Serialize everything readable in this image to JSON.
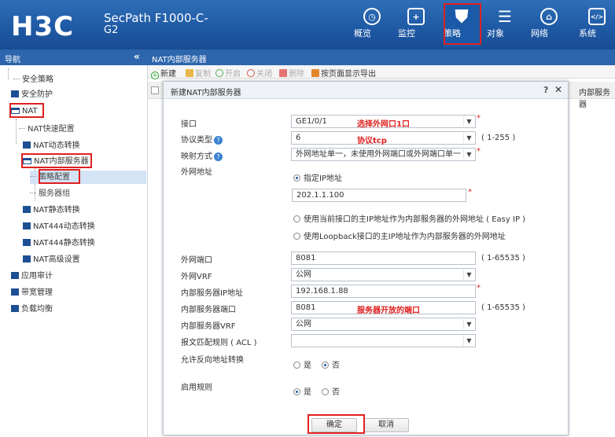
{
  "header": {
    "logo": "H3C",
    "product_line1": "SecPath F1000-C-",
    "product_line2": "G2",
    "nav": [
      {
        "label": "概览",
        "icon": "dashboard-icon",
        "glyph": "◷"
      },
      {
        "label": "监控",
        "icon": "monitor-icon",
        "glyph": "+"
      },
      {
        "label": "策略",
        "icon": "shield-icon",
        "glyph": "⛊"
      },
      {
        "label": "对象",
        "icon": "object-list-icon",
        "glyph": "☰"
      },
      {
        "label": "网络",
        "icon": "network-icon",
        "glyph": "⌂"
      },
      {
        "label": "系统",
        "icon": "code-icon",
        "glyph": "</>"
      }
    ]
  },
  "subbar": {
    "nav_title": "导航",
    "collapse": "«",
    "breadcrumb": "NAT内部服务器"
  },
  "sidebar": {
    "items": [
      {
        "label": "安全策略",
        "type": "leaf"
      },
      {
        "label": "安全防护",
        "type": "group"
      },
      {
        "label": "NAT",
        "type": "open-group"
      },
      {
        "label": "NAT快速配置",
        "type": "sub"
      },
      {
        "label": "NAT动态转换",
        "type": "group"
      },
      {
        "label": "NAT内部服务器",
        "type": "open-group"
      },
      {
        "label": "策略配置",
        "type": "sub-selected"
      },
      {
        "label": "服务器组",
        "type": "sub"
      },
      {
        "label": "NAT静态转换",
        "type": "group"
      },
      {
        "label": "NAT444动态转换",
        "type": "group"
      },
      {
        "label": "NAT444静态转换",
        "type": "group"
      },
      {
        "label": "NAT高级设置",
        "type": "group"
      },
      {
        "label": "应用审计",
        "type": "group"
      },
      {
        "label": "带宽管理",
        "type": "group"
      },
      {
        "label": "负载均衡",
        "type": "group"
      }
    ]
  },
  "toolbar": {
    "new": "新建",
    "copy": "复制",
    "enable": "开启",
    "disable": "关闭",
    "delete": "删除",
    "export": "按页面显示导出"
  },
  "table": {
    "column": "内部服务器"
  },
  "dialog": {
    "title": "新建NAT内部服务器",
    "help": "?",
    "close": "✕",
    "interface_label": "接口",
    "interface_value": "GE1/0/1",
    "interface_note": "选择外网口1口",
    "protocol_label": "协议类型",
    "protocol_value": "6",
    "protocol_note": "协议tcp",
    "protocol_hint": "( 1-255 )",
    "mapping_label": "映射方式",
    "mapping_value": "外网地址单一，未使用外网端口或外网端口单一",
    "ext_addr_label": "外网地址",
    "opt_specified_ip": "指定IP地址",
    "ext_ip_value": "202.1.1.100",
    "opt_easy_ip": "使用当前接口的主IP地址作为内部服务器的外网地址 ( Easy IP )",
    "opt_loopback": "使用Loopback接口的主IP地址作为内部服务器的外网地址",
    "ext_port_label": "外网端口",
    "ext_port_value": "8081",
    "ext_port_hint": "( 1-65535 )",
    "ext_vrf_label": "外网VRF",
    "ext_vrf_value": "公网",
    "int_ip_label": "内部服务器IP地址",
    "int_ip_value": "192.168.1.88",
    "int_port_label": "内部服务器端口",
    "int_port_value": "8081",
    "int_port_note": "服务器开放的端口",
    "int_port_hint": "( 1-65535 )",
    "int_vrf_label": "内部服务器VRF",
    "int_vrf_value": "公网",
    "acl_label": "报文匹配规则 ( ACL )",
    "acl_value": "",
    "reverse_label": "允许反向地址转换",
    "reverse_yes": "是",
    "reverse_no": "否",
    "enable_label": "启用规则",
    "enable_yes": "是",
    "enable_no": "否",
    "ok": "确定",
    "cancel": "取消"
  },
  "colors": {
    "header": "#1f5aa5",
    "highlight": "#e02020",
    "nav_icon": "#1d4f95"
  }
}
